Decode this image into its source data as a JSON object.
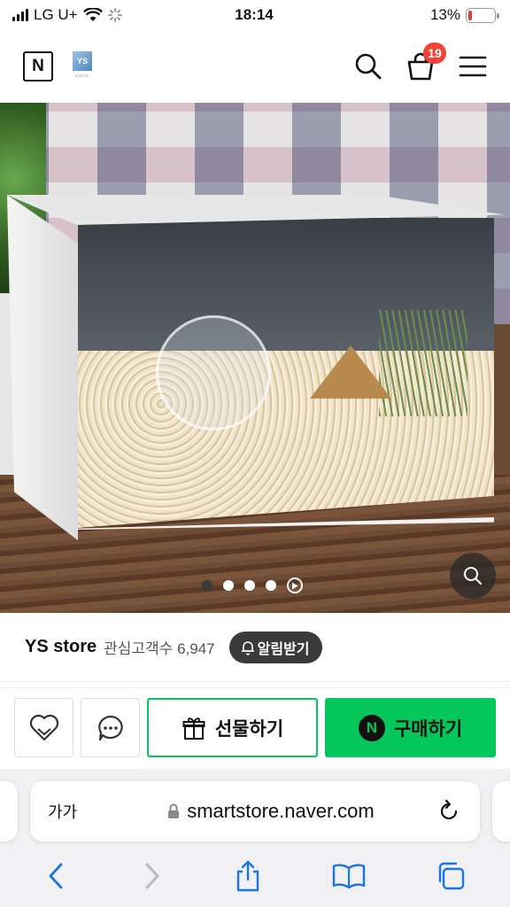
{
  "status_bar": {
    "carrier": "LG U+",
    "time": "18:14",
    "battery": "13%",
    "battery_level": 0.13,
    "battery_color": "#e53935"
  },
  "header": {
    "logo": "N",
    "store_logo_text": "YS",
    "store_logo_caption": "store",
    "cart_count": "19",
    "icons": [
      "search-icon",
      "cart-icon",
      "menu-icon"
    ]
  },
  "gallery": {
    "total_dots": 4,
    "active_index": 0,
    "has_video": true
  },
  "store": {
    "name": "YS store",
    "followers_label": "관심고객수 6,947",
    "alarm_label": "알림받기"
  },
  "actions": {
    "gift_label": "선물하기",
    "buy_label": "구매하기",
    "buy_badge": "N",
    "accent_color": "#03c75a"
  },
  "browser": {
    "reader_label": "가가",
    "url": "smartstore.naver.com"
  }
}
